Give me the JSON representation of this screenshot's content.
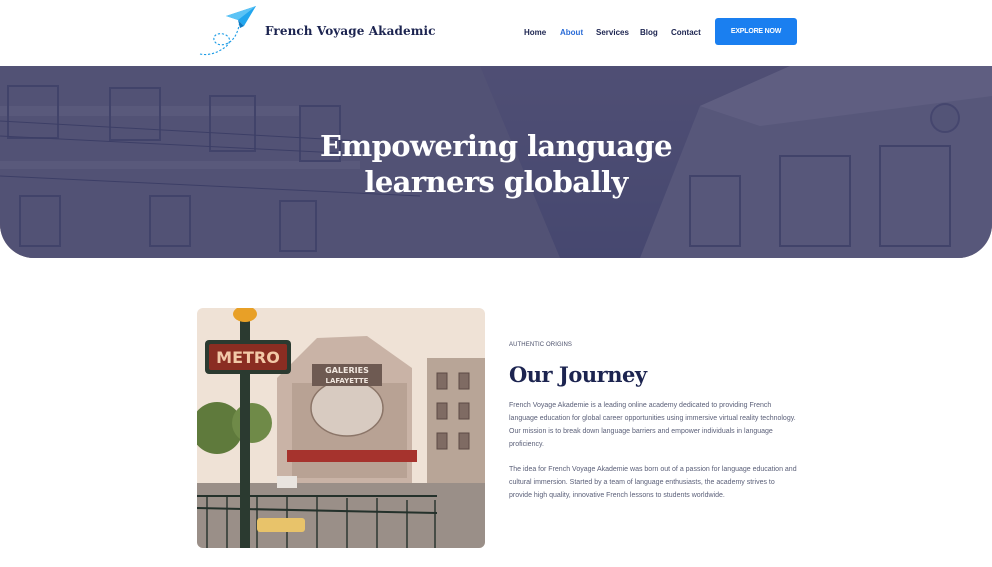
{
  "brand": {
    "name": "French Voyage Akademic",
    "logo_icon": "paper-plane-icon",
    "accent": "#1a7ff0"
  },
  "nav": {
    "items": [
      {
        "label": "Home",
        "active": false
      },
      {
        "label": "About",
        "active": true
      },
      {
        "label": "Services",
        "active": false
      },
      {
        "label": "Blog",
        "active": false
      },
      {
        "label": "Contact",
        "active": false
      }
    ],
    "cta_label": "EXPLORE NOW"
  },
  "hero": {
    "title_line1": "Empowering language",
    "title_line2": "learners globally",
    "overlay_color": "#3d4373"
  },
  "about": {
    "photo_signs": {
      "metro": "METRO",
      "store_line1": "GALERIES",
      "store_line2": "LAFAYETTE"
    },
    "eyebrow": "AUTHENTIC ORIGINS",
    "title": "Our Journey",
    "paragraph1": "French Voyage Akademie is a leading online academy dedicated to providing French language education for global career opportunities using immersive virtual reality technology. Our mission is to break down language barriers and empower individuals in language proficiency.",
    "paragraph2": "The idea for French Voyage Akademie was born out of a passion for language education and cultural immersion. Started by a team of language enthusiasts, the academy strives to provide high quality, innovative French lessons to students worldwide."
  }
}
